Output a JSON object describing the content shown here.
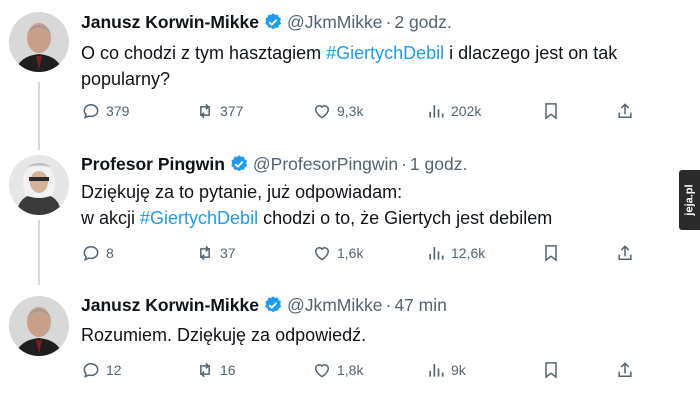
{
  "tweets": [
    {
      "author": "Janusz Korwin-Mikke",
      "handle": "@JkmMikke",
      "separator": "·",
      "time": "2 godz.",
      "text_before": "O co chodzi z tym hasztagiem ",
      "hashtag": "#GiertychDebil",
      "text_after": " i dlaczego jest on tak popularny?",
      "replies": "379",
      "retweets": "377",
      "likes": "9,3k",
      "views": "202k"
    },
    {
      "author": "Profesor Pingwin",
      "handle": "@ProfesorPingwin",
      "separator": "·",
      "time": "1 godz.",
      "line1": "Dziękuję za to pytanie, już odpowiadam:",
      "line2_before": "w akcji ",
      "hashtag": "#GiertychDebil",
      "line2_after": " chodzi o to, że Giertych jest debilem",
      "replies": "8",
      "retweets": "37",
      "likes": "1,6k",
      "views": "12,6k"
    },
    {
      "author": "Janusz Korwin-Mikke",
      "handle": "@JkmMikke",
      "separator": "·",
      "time": "47 min",
      "text": "Rozumiem. Dziękuję za odpowiedź.",
      "replies": "12",
      "retweets": "16",
      "likes": "1,8k",
      "views": "9k"
    }
  ],
  "watermark": "jeja.pl",
  "colors": {
    "accent": "#1d9bf0",
    "secondary_text": "#536471",
    "thread_line": "#cfd9de"
  },
  "icons": [
    "reply-icon",
    "retweet-icon",
    "like-icon",
    "views-icon",
    "bookmark-icon",
    "share-icon",
    "verified-badge-icon"
  ]
}
